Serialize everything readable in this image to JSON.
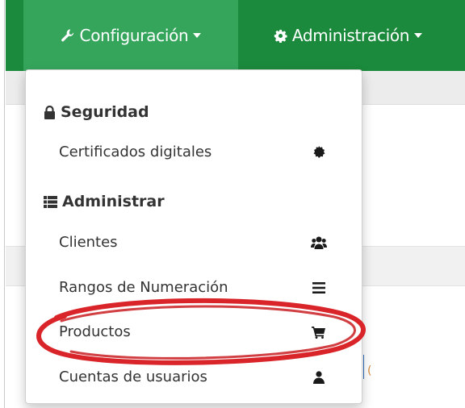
{
  "navbar": {
    "bg_color": "#1b8a3c",
    "active_bg_color": "#35a55c",
    "items": [
      {
        "label": "Configuración",
        "icon": "wrench-icon",
        "active": true
      },
      {
        "label": "Administración",
        "icon": "gear-icon",
        "active": false
      }
    ]
  },
  "dropdown": {
    "sections": [
      {
        "header": "Seguridad",
        "icon": "lock-icon",
        "items": [
          {
            "label": "Certificados digitales",
            "icon": "certificate-icon"
          }
        ]
      },
      {
        "header": "Administrar",
        "icon": "list-icon",
        "items": [
          {
            "label": "Clientes",
            "icon": "users-icon"
          },
          {
            "label": "Rangos de Numeración",
            "icon": "bars-icon"
          },
          {
            "label": "Productos",
            "icon": "shopping-cart-icon",
            "highlighted": true
          },
          {
            "label": "Cuentas de usuarios",
            "icon": "user-icon"
          }
        ]
      }
    ]
  },
  "annotation": {
    "type": "ellipse",
    "color": "#d9252a",
    "target": "Productos"
  }
}
